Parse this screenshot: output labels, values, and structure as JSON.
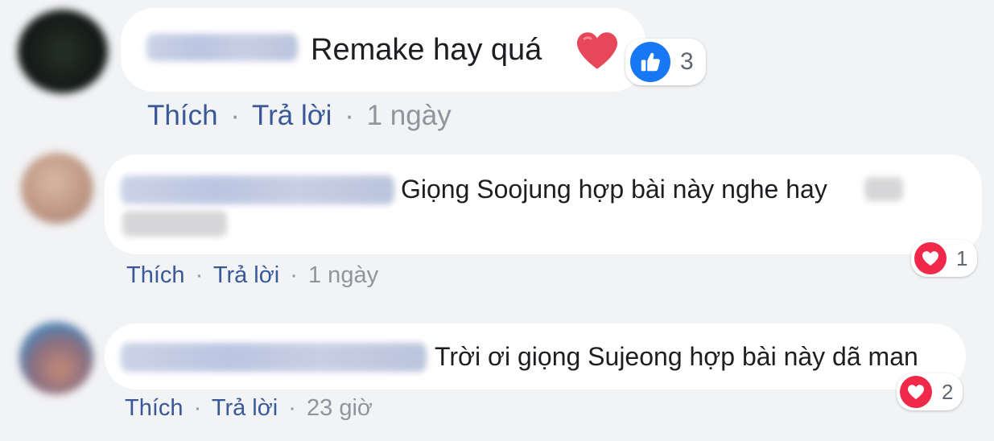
{
  "colors": {
    "page_background": "#f2f3f5",
    "bubble": "#ffffff",
    "action_link": "#385898",
    "muted": "#90949c",
    "like_blue": "#1877f2",
    "love_red": "#f0284a"
  },
  "comments": [
    {
      "text": "Remake hay quá",
      "emoji": "red-heart",
      "reaction": {
        "type": "like-icon",
        "count": "3"
      },
      "actions": {
        "like": "Thích",
        "reply": "Trả lời",
        "time": "1 ngày",
        "separator": "·"
      }
    },
    {
      "text": "Giọng Soojung hợp bài này nghe hay",
      "reaction": {
        "type": "love-icon",
        "count": "1"
      },
      "actions": {
        "like": "Thích",
        "reply": "Trả lời",
        "time": "1 ngày",
        "separator": "·"
      }
    },
    {
      "text": "Trời ơi giọng Sujeong hợp bài này dã man",
      "reaction": {
        "type": "love-icon",
        "count": "2"
      },
      "actions": {
        "like": "Thích",
        "reply": "Trả lời",
        "time": "23 giờ",
        "separator": "·"
      }
    }
  ]
}
